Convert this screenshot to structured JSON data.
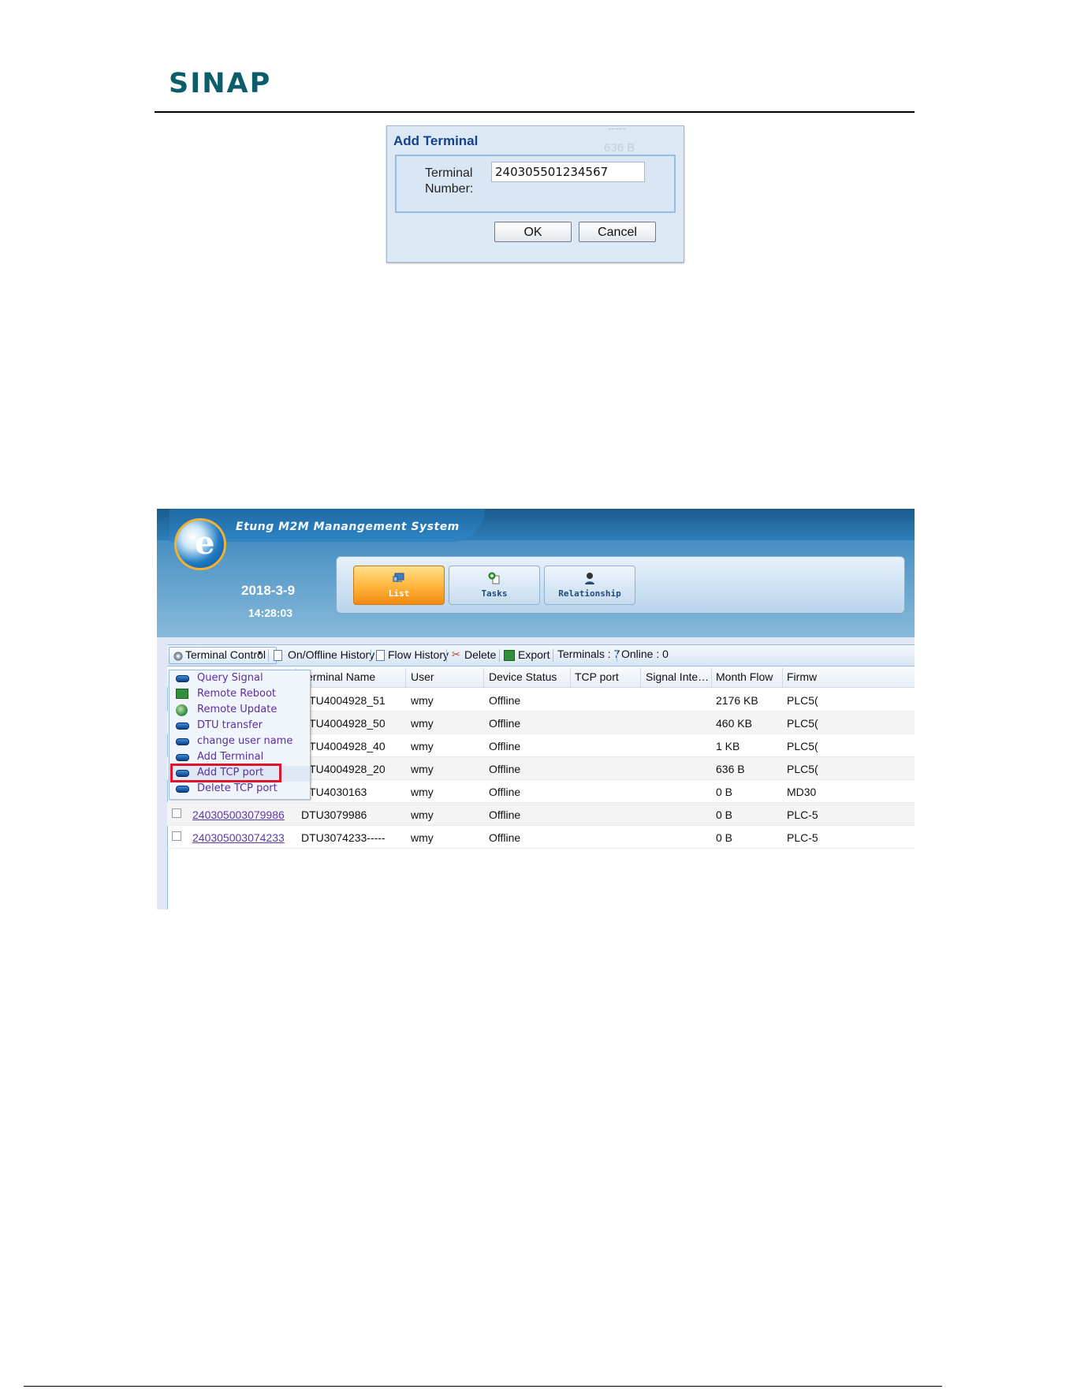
{
  "header": {
    "logo": "SINAP"
  },
  "dialog": {
    "title": "Add Terminal",
    "ghost_line1": "-----",
    "ghost_line2": "636 B",
    "field_label": "Terminal Number:",
    "field_value": "240305501234567",
    "ok_label": "OK",
    "cancel_label": "Cancel"
  },
  "app": {
    "title": "Etung M2M Manangement System",
    "date": "2018-3-9",
    "time": "14:28:03",
    "tabs": [
      {
        "label": "List",
        "active": true
      },
      {
        "label": "Tasks",
        "active": false
      },
      {
        "label": "Relationship",
        "active": false
      }
    ],
    "toolbar": {
      "terminal_control": "Terminal Control",
      "history": "On/Offline History",
      "flow_history": "Flow History",
      "delete": "Delete",
      "export": "Export",
      "terminals": "Terminals : 7",
      "online": "Online : 0"
    },
    "columns": [
      "Terminal Name",
      "User",
      "Device Status",
      "TCP port",
      "Signal Inte…",
      "Month Flow",
      "Firmw"
    ],
    "rows": [
      {
        "id": "",
        "name": "DTU4004928_51",
        "user": "wmy",
        "status": "Offline",
        "tcp": "",
        "signal": "",
        "flow": "2176 KB",
        "firmware": "PLC5("
      },
      {
        "id": "",
        "name": "DTU4004928_50",
        "user": "wmy",
        "status": "Offline",
        "tcp": "",
        "signal": "",
        "flow": "460 KB",
        "firmware": "PLC5("
      },
      {
        "id": "",
        "name": "DTU4004928_40",
        "user": "wmy",
        "status": "Offline",
        "tcp": "",
        "signal": "",
        "flow": "1 KB",
        "firmware": "PLC5("
      },
      {
        "id": "",
        "name": "DTU4004928_20",
        "user": "wmy",
        "status": "Offline",
        "tcp": "",
        "signal": "",
        "flow": "636 B",
        "firmware": "PLC5("
      },
      {
        "id": "",
        "name": "DTU4030163",
        "user": "wmy",
        "status": "Offline",
        "tcp": "",
        "signal": "",
        "flow": "0 B",
        "firmware": "MD30"
      },
      {
        "id": "240305003079986",
        "name": "DTU3079986",
        "user": "wmy",
        "status": "Offline",
        "tcp": "",
        "signal": "",
        "flow": "0 B",
        "firmware": "PLC-5"
      },
      {
        "id": "240305003074233",
        "name": "DTU3074233-----",
        "user": "wmy",
        "status": "Offline",
        "tcp": "",
        "signal": "",
        "flow": "0 B",
        "firmware": "PLC-5"
      }
    ],
    "menu": [
      "Query Signal",
      "Remote Reboot",
      "Remote Update",
      "DTU transfer",
      "change user name",
      "Add Terminal",
      "Add TCP port",
      "Delete TCP port"
    ],
    "highlighted_menu_item": "Add TCP port",
    "colors": {
      "accent_tab": "#f5a623",
      "highlight_box": "#e0142a",
      "menu_text": "#5b2ea0"
    }
  }
}
